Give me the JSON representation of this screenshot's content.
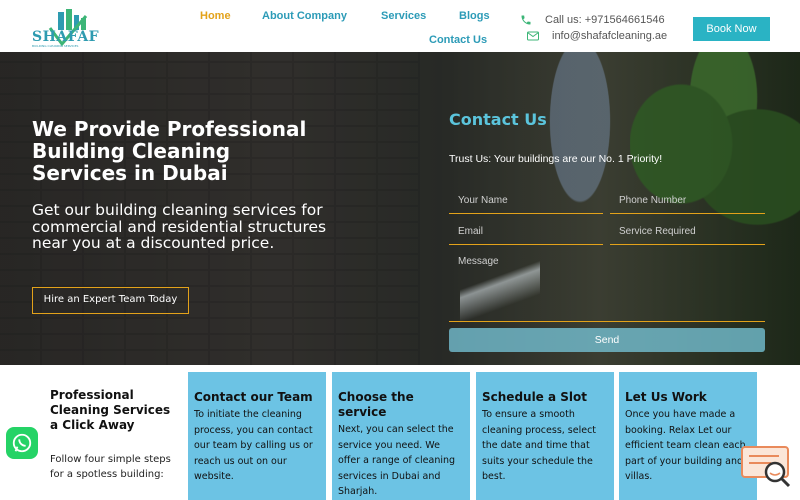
{
  "brand": {
    "name": "SHAFAF",
    "tagline": "BUILDING CLEANING SERVICES"
  },
  "nav": {
    "home": "Home",
    "about": "About Company",
    "services": "Services",
    "blogs": "Blogs",
    "contact": "Contact Us"
  },
  "contact": {
    "phone": "Call us: +971564661546",
    "email": "info@shafafcleaning.ae"
  },
  "header": {
    "book_label": "Book Now"
  },
  "hero": {
    "title": "We Provide Professional Building Cleaning Services in Dubai",
    "subtitle": "Get our building cleaning services for commercial and residential structures near you at a discounted price.",
    "cta_label": "Hire an Expert Team Today"
  },
  "form": {
    "title": "Contact Us",
    "tagline": "Trust Us: Your buildings are our No. 1 Priority!",
    "name_placeholder": "Your Name",
    "phone_placeholder": "Phone Number",
    "email_placeholder": "Email",
    "service_placeholder": "Service Required",
    "message_placeholder": "Message",
    "send_label": "Send"
  },
  "steps": {
    "intro_title": "Professional Cleaning Services a Click Away",
    "intro_body": "Follow four simple steps for a spotless building:",
    "cards": [
      {
        "title": "Contact our Team",
        "body": "To initiate the cleaning process, you can contact our team by calling us or reach us out on our website."
      },
      {
        "title": "Choose the service",
        "body": "Next, you can select the service you need. We offer a range of cleaning services in Dubai and Sharjah."
      },
      {
        "title": "Schedule a Slot",
        "body": "To ensure a smooth cleaning process, select the date and time that suits your schedule the best."
      },
      {
        "title": "Let Us Work",
        "body": "Once you have made a booking. Relax Let our efficient team clean each part of your building and villas."
      }
    ]
  },
  "icons": {
    "phone": "phone-icon",
    "email": "envelope-icon",
    "whatsapp": "whatsapp-icon",
    "chat": "chat-search-icon"
  },
  "colors": {
    "accent": "#2c9bb7",
    "active_nav": "#e3a21a",
    "button": "#2ab3c4",
    "card_bg": "#6cc3e4",
    "form_title": "#5bc4dc",
    "whatsapp": "#25d366"
  }
}
